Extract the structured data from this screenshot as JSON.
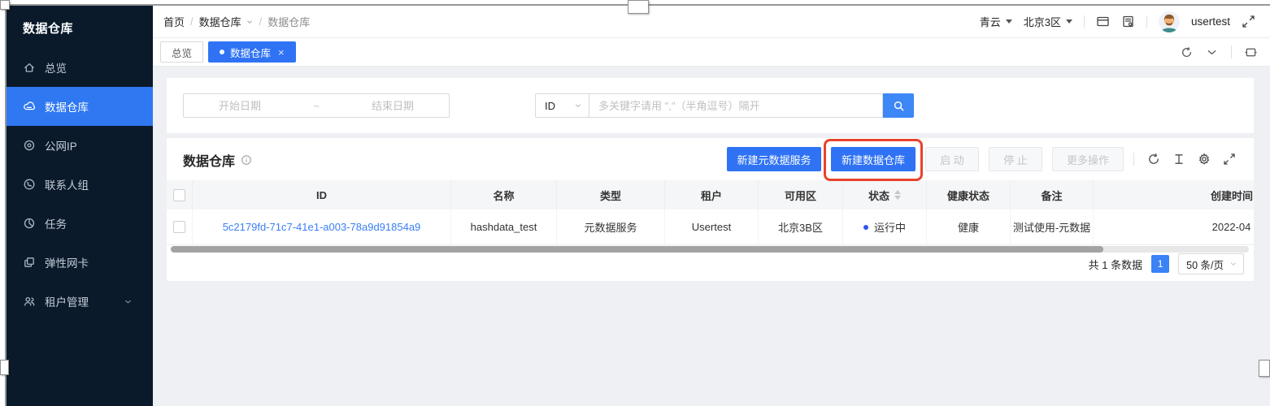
{
  "sidebar": {
    "title": "数据仓库",
    "items": [
      {
        "label": "总览",
        "icon": "home-icon"
      },
      {
        "label": "数据仓库",
        "icon": "warehouse-icon"
      },
      {
        "label": "公网IP",
        "icon": "public-ip-icon"
      },
      {
        "label": "联系人组",
        "icon": "contact-group-icon"
      },
      {
        "label": "任务",
        "icon": "task-icon"
      },
      {
        "label": "弹性网卡",
        "icon": "nic-icon"
      },
      {
        "label": "租户管理",
        "icon": "tenant-icon"
      }
    ]
  },
  "topbar": {
    "breadcrumb": {
      "home": "首页",
      "sep": "/",
      "parent": "数据仓库",
      "current": "数据仓库"
    },
    "org": "青云",
    "region": "北京3区",
    "username": "usertest"
  },
  "tabbar": {
    "tabs": [
      {
        "label": "总览"
      },
      {
        "label": "数据仓库",
        "close": "×"
      }
    ]
  },
  "filter": {
    "start_placeholder": "开始日期",
    "range_separator": "~",
    "end_placeholder": "结束日期",
    "field": "ID",
    "keyword_placeholder": "多关键字请用 \",\"（半角逗号）隔开"
  },
  "section": {
    "title": "数据仓库",
    "create_metadata": "新建元数据服务",
    "create_warehouse": "新建数据仓库",
    "start": "启 动",
    "stop": "停 止",
    "more": "更多操作"
  },
  "table": {
    "columns": [
      "ID",
      "名称",
      "类型",
      "租户",
      "可用区",
      "状态",
      "健康状态",
      "备注",
      "创建时间"
    ],
    "row": {
      "id": "5c2179fd-71c7-41e1-a003-78a9d91854a9",
      "name": "hashdata_test",
      "type": "元数据服务",
      "tenant": "Usertest",
      "zone": "北京3B区",
      "status": "运行中",
      "health": "健康",
      "remark": "测试使用-元数据",
      "created": "2022-04"
    }
  },
  "pagination": {
    "total": "共 1 条数据",
    "page": "1",
    "size": "50 条/页"
  },
  "colors": {
    "primary": "#2f73f4",
    "annotation_red": "#e8432c",
    "sidebar_bg": "#0a1a2b",
    "sidebar_active": "#2f78f2",
    "link": "#3b7ef8",
    "status_dot": "#2f54eb",
    "page_bg": "#eef0f4"
  }
}
